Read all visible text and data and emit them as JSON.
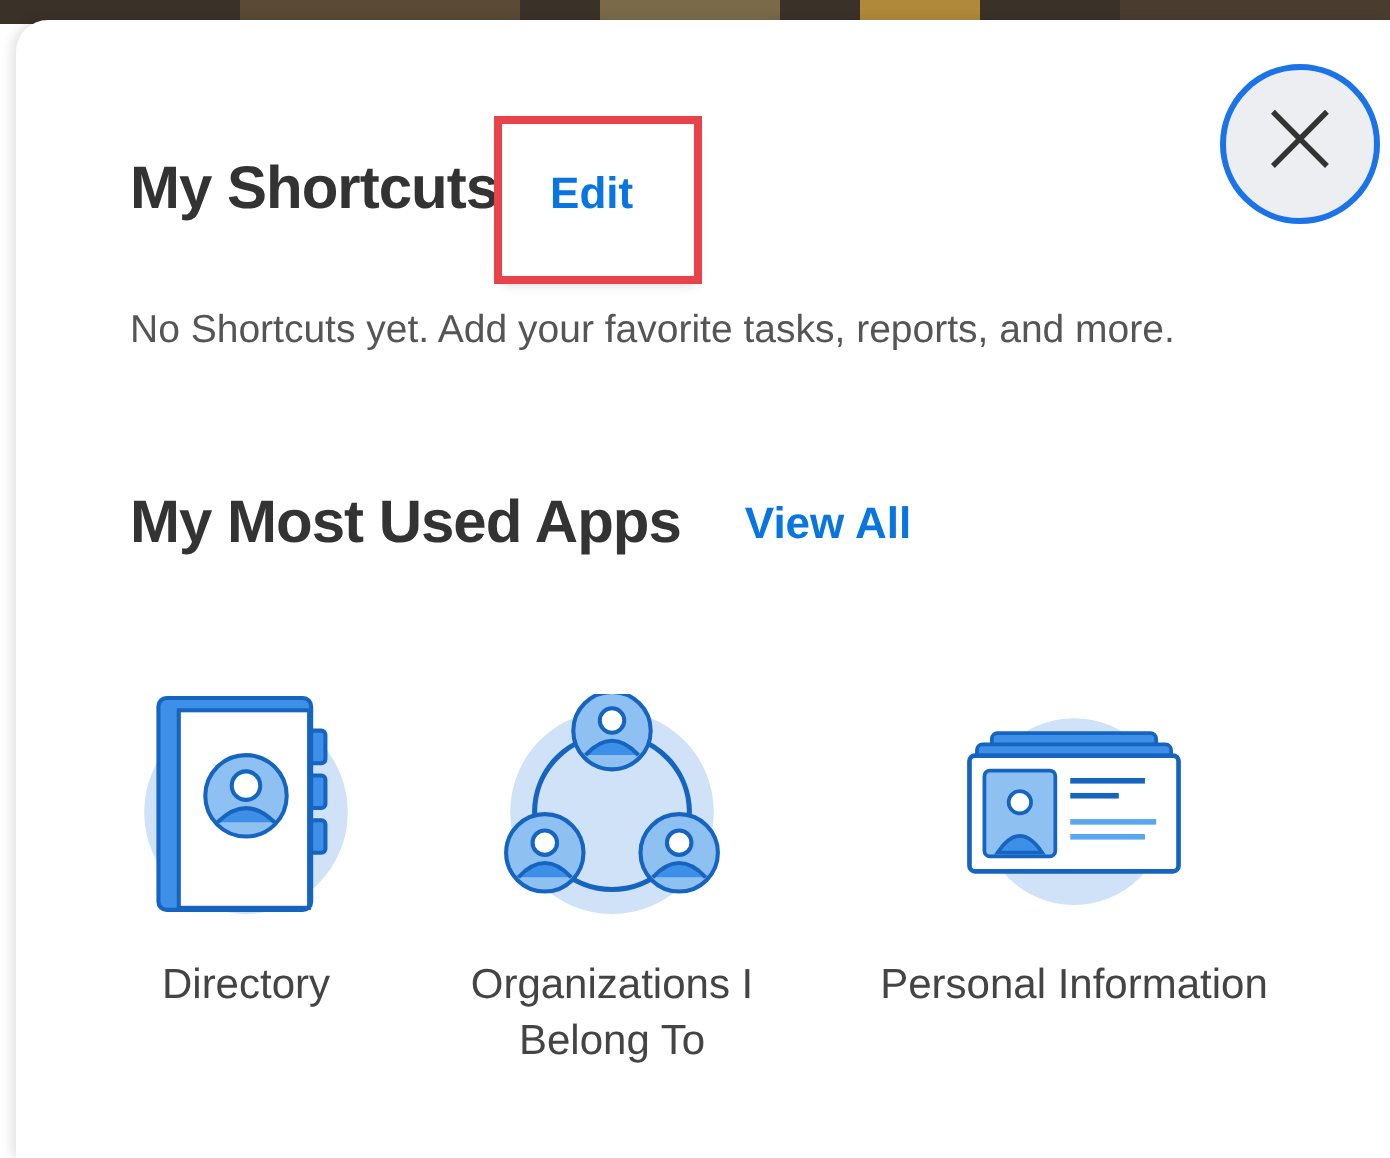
{
  "shortcuts": {
    "title": "My Shortcuts",
    "edit_link": {
      "label": "Edit",
      "highlighted": true
    },
    "message": "No Shortcuts yet. Add your favorite tasks, reports, and more."
  },
  "apps": {
    "title": "My Most Used Apps",
    "view_all": "View All",
    "items": [
      {
        "kind": "directory",
        "label": "Directory"
      },
      {
        "kind": "organizations",
        "label": "Organizations I Belong To"
      },
      {
        "kind": "personal",
        "label": "Personal Information"
      }
    ]
  },
  "close_button": {
    "label": "×"
  }
}
